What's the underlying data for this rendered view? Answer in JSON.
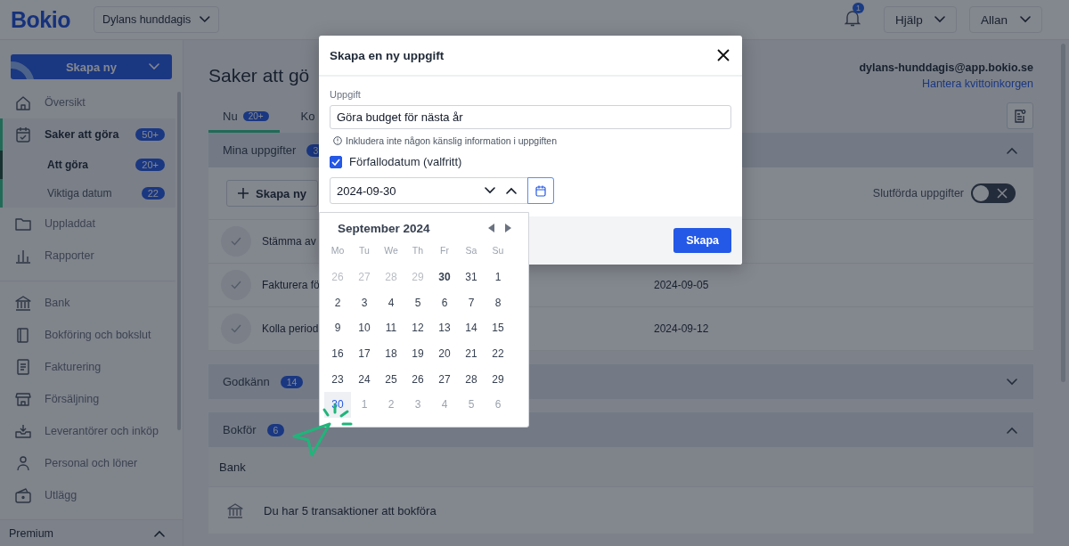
{
  "header": {
    "logo": "Bokio",
    "company": "Dylans hunddagis",
    "notifications": "1",
    "help": "Hjälp",
    "user": "Allan"
  },
  "sidebar": {
    "create_button": "Skapa ny",
    "items": [
      {
        "label": "Översikt",
        "selected": false
      },
      {
        "label": "Saker att göra",
        "selected": true,
        "badge": "50+",
        "children": [
          {
            "label": "Att göra",
            "badge": "20+",
            "selected": true
          },
          {
            "label": "Viktiga datum",
            "badge": "22",
            "selected": false
          }
        ]
      },
      {
        "label": "Uppladdat",
        "selected": false
      },
      {
        "label": "Rapporter",
        "selected": false
      },
      {
        "label": "Bank",
        "selected": false
      },
      {
        "label": "Bokföring och bokslut",
        "selected": false
      },
      {
        "label": "Fakturering",
        "selected": false
      },
      {
        "label": "Försäljning",
        "selected": false
      },
      {
        "label": "Leverantörer och inköp",
        "selected": false
      },
      {
        "label": "Personal och löner",
        "selected": false
      },
      {
        "label": "Utlägg",
        "selected": false
      }
    ],
    "footer": "Premium"
  },
  "page": {
    "title": "Saker att gö",
    "email": "dylans-hunddagis@app.bokio.se",
    "email_link": "Hantera kvittoinkorgen",
    "tabs": [
      {
        "label": "Nu",
        "badge": "20+",
        "selected": true
      },
      {
        "label": "Ko",
        "selected": false
      }
    ],
    "sections": [
      {
        "kind": "tasks",
        "title": "Mina uppgifter",
        "badge": "3",
        "expanded": true,
        "create_button": "Skapa ny",
        "toggle": {
          "label": "Slutförda uppgifter",
          "on": false
        },
        "tasks": [
          {
            "title": "Stämma av"
          },
          {
            "title": "Fakturera fö",
            "due": "2024-09-05"
          },
          {
            "title": "Kolla period",
            "due": "2024-09-12"
          }
        ]
      },
      {
        "kind": "plain",
        "title": "Godkänn",
        "badge": "14",
        "expanded": false
      },
      {
        "kind": "groups",
        "title": "Bokför",
        "badge": "6",
        "expanded": true,
        "groups": [
          {
            "title": "Bank",
            "items": [
              "Du har 5 transaktioner att bokföra"
            ]
          }
        ]
      }
    ]
  },
  "modal": {
    "title": "Skapa en ny uppgift",
    "task_label": "Uppgift",
    "task_value": "Göra budget för nästa år",
    "hint": "Inkludera inte någon känslig information i uppgiften",
    "due_checkbox": {
      "label": "Förfallodatum (valfritt)",
      "checked": true
    },
    "date_value": "2024-09-30",
    "submit": "Skapa"
  },
  "calendar": {
    "title": "September 2024",
    "weekdays": [
      "Mo",
      "Tu",
      "We",
      "Th",
      "Fr",
      "Sa",
      "Su"
    ],
    "weeks": [
      [
        {
          "day": "26",
          "disabled": true,
          "muted": false,
          "today": false,
          "selected": false
        },
        {
          "day": "27",
          "disabled": true,
          "muted": false,
          "today": false,
          "selected": false
        },
        {
          "day": "28",
          "disabled": true,
          "muted": false,
          "today": false,
          "selected": false
        },
        {
          "day": "29",
          "disabled": true,
          "muted": false,
          "today": false,
          "selected": false
        },
        {
          "day": "30",
          "disabled": false,
          "muted": false,
          "today": true,
          "selected": false
        },
        {
          "day": "31",
          "disabled": false,
          "muted": false,
          "today": false,
          "selected": false
        },
        {
          "day": "1",
          "disabled": false,
          "muted": false,
          "today": false,
          "selected": false
        }
      ],
      [
        {
          "day": "2",
          "disabled": false,
          "muted": false,
          "today": false,
          "selected": false
        },
        {
          "day": "3",
          "disabled": false,
          "muted": false,
          "today": false,
          "selected": false
        },
        {
          "day": "4",
          "disabled": false,
          "muted": false,
          "today": false,
          "selected": false
        },
        {
          "day": "5",
          "disabled": false,
          "muted": false,
          "today": false,
          "selected": false
        },
        {
          "day": "6",
          "disabled": false,
          "muted": false,
          "today": false,
          "selected": false
        },
        {
          "day": "7",
          "disabled": false,
          "muted": false,
          "today": false,
          "selected": false
        },
        {
          "day": "8",
          "disabled": false,
          "muted": false,
          "today": false,
          "selected": false
        }
      ],
      [
        {
          "day": "9",
          "disabled": false,
          "muted": false,
          "today": false,
          "selected": false
        },
        {
          "day": "10",
          "disabled": false,
          "muted": false,
          "today": false,
          "selected": false
        },
        {
          "day": "11",
          "disabled": false,
          "muted": false,
          "today": false,
          "selected": false
        },
        {
          "day": "12",
          "disabled": false,
          "muted": false,
          "today": false,
          "selected": false
        },
        {
          "day": "13",
          "disabled": false,
          "muted": false,
          "today": false,
          "selected": false
        },
        {
          "day": "14",
          "disabled": false,
          "muted": false,
          "today": false,
          "selected": false
        },
        {
          "day": "15",
          "disabled": false,
          "muted": false,
          "today": false,
          "selected": false
        }
      ],
      [
        {
          "day": "16",
          "disabled": false,
          "muted": false,
          "today": false,
          "selected": false
        },
        {
          "day": "17",
          "disabled": false,
          "muted": false,
          "today": false,
          "selected": false
        },
        {
          "day": "18",
          "disabled": false,
          "muted": false,
          "today": false,
          "selected": false
        },
        {
          "day": "19",
          "disabled": false,
          "muted": false,
          "today": false,
          "selected": false
        },
        {
          "day": "20",
          "disabled": false,
          "muted": false,
          "today": false,
          "selected": false
        },
        {
          "day": "21",
          "disabled": false,
          "muted": false,
          "today": false,
          "selected": false
        },
        {
          "day": "22",
          "disabled": false,
          "muted": false,
          "today": false,
          "selected": false
        }
      ],
      [
        {
          "day": "23",
          "disabled": false,
          "muted": false,
          "today": false,
          "selected": false
        },
        {
          "day": "24",
          "disabled": false,
          "muted": false,
          "today": false,
          "selected": false
        },
        {
          "day": "25",
          "disabled": false,
          "muted": false,
          "today": false,
          "selected": false
        },
        {
          "day": "26",
          "disabled": false,
          "muted": false,
          "today": false,
          "selected": false
        },
        {
          "day": "27",
          "disabled": false,
          "muted": false,
          "today": false,
          "selected": false
        },
        {
          "day": "28",
          "disabled": false,
          "muted": false,
          "today": false,
          "selected": false
        },
        {
          "day": "29",
          "disabled": false,
          "muted": false,
          "today": false,
          "selected": false
        }
      ],
      [
        {
          "day": "30",
          "disabled": false,
          "muted": false,
          "today": false,
          "selected": true
        },
        {
          "day": "1",
          "disabled": false,
          "muted": true,
          "today": false,
          "selected": false
        },
        {
          "day": "2",
          "disabled": false,
          "muted": true,
          "today": false,
          "selected": false
        },
        {
          "day": "3",
          "disabled": false,
          "muted": true,
          "today": false,
          "selected": false
        },
        {
          "day": "4",
          "disabled": false,
          "muted": true,
          "today": false,
          "selected": false
        },
        {
          "day": "5",
          "disabled": false,
          "muted": true,
          "today": false,
          "selected": false
        },
        {
          "day": "6",
          "disabled": false,
          "muted": true,
          "today": false,
          "selected": false
        }
      ]
    ]
  }
}
